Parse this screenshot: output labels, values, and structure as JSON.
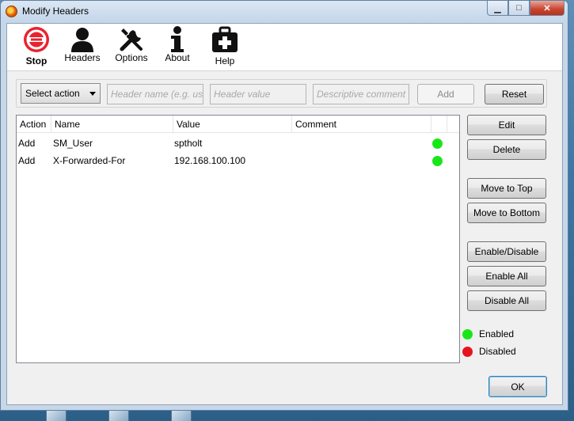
{
  "window": {
    "title": "Modify Headers",
    "minimize_glyph": "▁",
    "maximize_glyph": "□",
    "close_glyph": "✕"
  },
  "toolbar": {
    "items": [
      {
        "label": "Stop",
        "icon": "stop-icon"
      },
      {
        "label": "Headers",
        "icon": "user-icon"
      },
      {
        "label": "Options",
        "icon": "wrench-screwdriver-icon"
      },
      {
        "label": "About",
        "icon": "info-icon"
      },
      {
        "label": "Help",
        "icon": "medical-kit-icon"
      }
    ]
  },
  "action_bar": {
    "select_action": "Select action",
    "header_name_placeholder": "Header name (e.g. us",
    "header_value_placeholder": "Header value",
    "comment_placeholder": "Descriptive comment",
    "add_label": "Add",
    "reset_label": "Reset"
  },
  "table": {
    "columns": [
      "Action",
      "Name",
      "Value",
      "Comment"
    ],
    "rows": [
      {
        "action": "Add",
        "name": "SM_User",
        "value": "sptholt",
        "comment": "",
        "enabled": true
      },
      {
        "action": "Add",
        "name": "X-Forwarded-For",
        "value": "192.168.100.100",
        "comment": "",
        "enabled": true
      }
    ]
  },
  "side_buttons": {
    "edit": "Edit",
    "delete": "Delete",
    "move_to_top": "Move to Top",
    "move_to_bottom": "Move to Bottom",
    "enable_disable": "Enable/Disable",
    "enable_all": "Enable All",
    "disable_all": "Disable All"
  },
  "legend": {
    "enabled": "Enabled",
    "disabled": "Disabled"
  },
  "ok_label": "OK",
  "colors": {
    "enabled": "#19e619",
    "disabled": "#e6141e",
    "stop_red": "#e8232f"
  }
}
